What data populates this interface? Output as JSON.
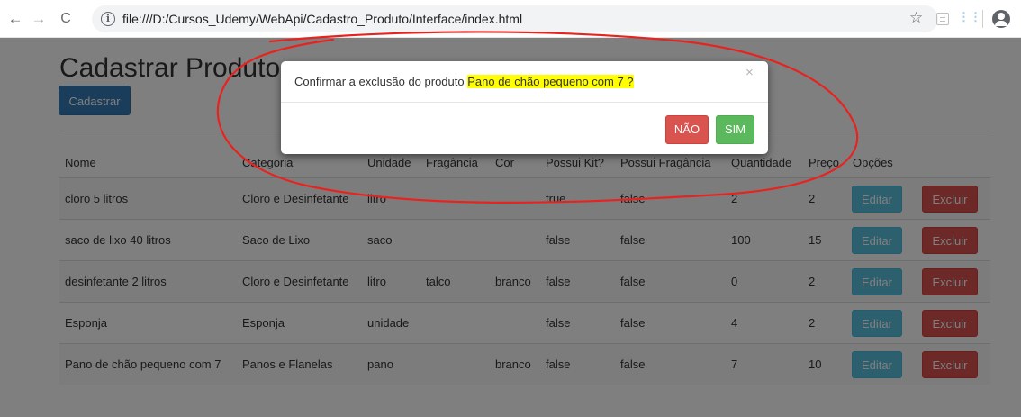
{
  "browser": {
    "url": "file:///D:/Cursos_Udemy/WebApi/Cadastro_Produto/Interface/index.html",
    "back_icon": "←",
    "forward_icon": "→",
    "reload_icon": "C",
    "info_icon": "i",
    "star_icon": "☆",
    "ext2_icon": "⋮⋮"
  },
  "page": {
    "title": "Cadastrar Produtos",
    "cadastrar_label": "Cadastrar"
  },
  "table": {
    "headers": [
      "Nome",
      "Categoria",
      "Unidade",
      "Fragância",
      "Cor",
      "Possui Kit?",
      "Possui Fragância",
      "Quantidade",
      "Preço",
      "Opções"
    ],
    "rows": [
      [
        "cloro 5 litros",
        "Cloro e Desinfetante",
        "litro",
        "",
        "",
        "true",
        "false",
        "2",
        "2"
      ],
      [
        "saco de lixo 40 litros",
        "Saco de Lixo",
        "saco",
        "",
        "",
        "false",
        "false",
        "100",
        "15"
      ],
      [
        "desinfetante 2 litros",
        "Cloro e Desinfetante",
        "litro",
        "talco",
        "branco",
        "false",
        "false",
        "0",
        "2"
      ],
      [
        "Esponja",
        "Esponja",
        "unidade",
        "",
        "",
        "false",
        "false",
        "4",
        "2"
      ],
      [
        "Pano de chão pequeno com 7",
        "Panos e Flanelas",
        "pano",
        "",
        "branco",
        "false",
        "false",
        "7",
        "10"
      ]
    ],
    "edit_label": "Editar",
    "delete_label": "Excluir"
  },
  "modal": {
    "message_prefix": "Confirmar a exclusão do produto ",
    "message_highlight": "Pano de chão pequeno com 7 ?",
    "close_symbol": "×",
    "no_label": "NÃO",
    "yes_label": "SIM"
  },
  "colors": {
    "primary": "#337ab7",
    "info": "#5bc0de",
    "danger": "#d9534f",
    "success": "#5cb85c",
    "highlight": "#ffff00",
    "annotation": "#e8231f"
  }
}
